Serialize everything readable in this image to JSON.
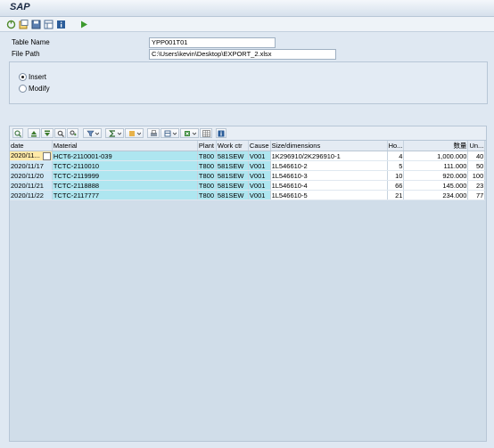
{
  "window": {
    "title": "SAP"
  },
  "toolbar": {
    "icons": [
      "execute-icon",
      "variant-icon",
      "save-variant-icon",
      "layout-icon",
      "info-icon",
      "run-icon"
    ]
  },
  "form": {
    "table_name_label": "Table Name",
    "table_name_value": "YPP001T01",
    "file_path_label": "File Path",
    "file_path_value": "C:\\Users\\kevin\\Desktop\\EXPORT_2.xlsx",
    "options": [
      {
        "label": "Insert",
        "selected": true
      },
      {
        "label": "Modify",
        "selected": false
      }
    ]
  },
  "grid": {
    "columns": [
      "date",
      "Material",
      "Plant",
      "Work ctr",
      "Cause",
      "Size/dimensions",
      "Ho...",
      "数量",
      "Un..."
    ],
    "rows": [
      [
        "2020/11...",
        "HCT6-2110001-039",
        "T800",
        "581SEW",
        "V001",
        "1K296910/2K296910-1",
        "4",
        "1,000.000",
        "40"
      ],
      [
        "2020/11/17",
        "TCTC-2110010",
        "T800",
        "581SEW",
        "V001",
        "1L546610-2",
        "5",
        "111.000",
        "50"
      ],
      [
        "2020/11/20",
        "TCTC-2119999",
        "T800",
        "581SEW",
        "V001",
        "1L546610-3",
        "10",
        "920.000",
        "100"
      ],
      [
        "2020/11/21",
        "TCTC-2118888",
        "T800",
        "581SEW",
        "V001",
        "1L546610-4",
        "66",
        "145.000",
        "23"
      ],
      [
        "2020/11/22",
        "TCTC-2117777",
        "T800",
        "581SEW",
        "V001",
        "1L546610-5",
        "21",
        "234.000",
        "77"
      ]
    ]
  }
}
